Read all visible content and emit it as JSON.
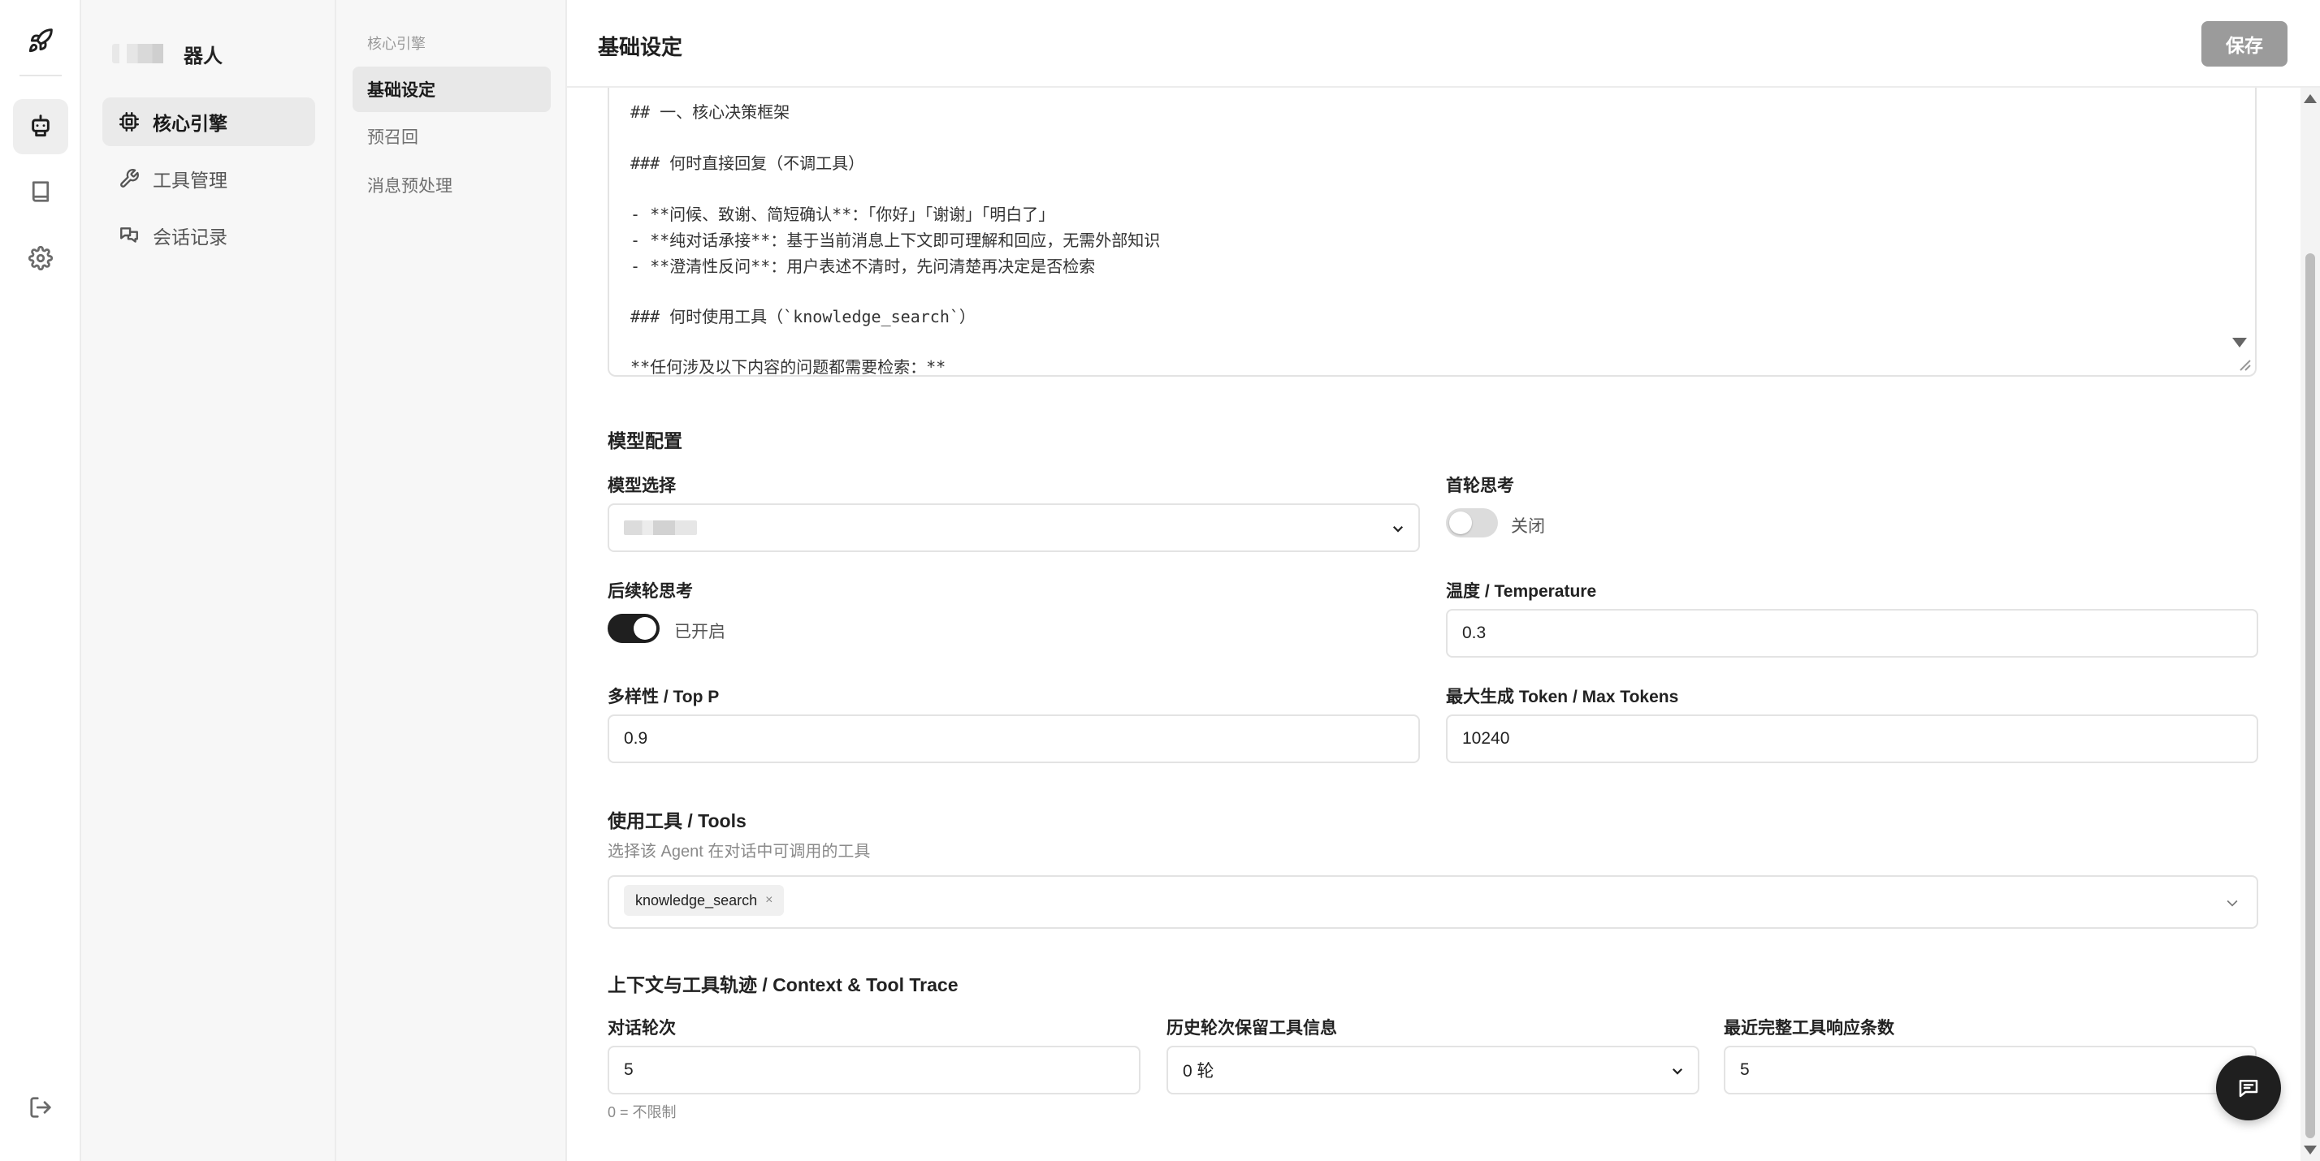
{
  "rail": {
    "icons": [
      "rocket-icon",
      "robot-icon",
      "book-icon",
      "gear-icon",
      "logout-icon"
    ]
  },
  "brand": {
    "name_visible": "器人"
  },
  "sidebar": {
    "items": [
      {
        "label": "核心引擎",
        "icon": "cpu-icon",
        "active": true
      },
      {
        "label": "工具管理",
        "icon": "wrench-icon",
        "active": false
      },
      {
        "label": "会话记录",
        "icon": "chat-log-icon",
        "active": false
      }
    ]
  },
  "subnav": {
    "heading": "核心引擎",
    "items": [
      {
        "label": "基础设定",
        "active": true
      },
      {
        "label": "预召回",
        "active": false
      },
      {
        "label": "消息预处理",
        "active": false
      }
    ]
  },
  "header": {
    "title": "基础设定",
    "save_label": "保存"
  },
  "prompt": {
    "lines": [
      "## 一、核心决策框架",
      "",
      "### 何时直接回复（不调工具）",
      "",
      "- **问候、致谢、简短确认**：「你好」「谢谢」「明白了」",
      "- **纯对话承接**：基于当前消息上下文即可理解和回应，无需外部知识",
      "- **澄清性反问**：用户表述不清时，先问清楚再决定是否检索",
      "",
      "### 何时使用工具（`knowledge_search`）",
      "",
      "**任何涉及以下内容的问题都需要检索：**"
    ]
  },
  "model_config": {
    "title": "模型配置",
    "model_select_label": "模型选择",
    "first_round_label": "首轮思考",
    "first_round_state": "关闭",
    "later_round_label": "后续轮思考",
    "later_round_state": "已开启",
    "temperature_label": "温度 / Temperature",
    "temperature_value": "0.3",
    "top_p_label": "多样性 / Top P",
    "top_p_value": "0.9",
    "max_tokens_label": "最大生成 Token / Max Tokens",
    "max_tokens_value": "10240"
  },
  "tools": {
    "title": "使用工具 / Tools",
    "description": "选择该 Agent 在对话中可调用的工具",
    "selected": [
      "knowledge_search"
    ],
    "remove_glyph": "×"
  },
  "context": {
    "title": "上下文与工具轨迹 / Context & Tool Trace",
    "rounds_label": "对话轮次",
    "rounds_value": "5",
    "rounds_hint": "0 = 不限制",
    "history_label": "历史轮次保留工具信息",
    "history_value": "0 轮",
    "recent_label": "最近完整工具响应条数",
    "recent_value": "5"
  },
  "colors": {
    "accent": "#1f1f1f",
    "save_button": "#9b9b9b",
    "sidebar_bg": "#f7f7f7"
  }
}
